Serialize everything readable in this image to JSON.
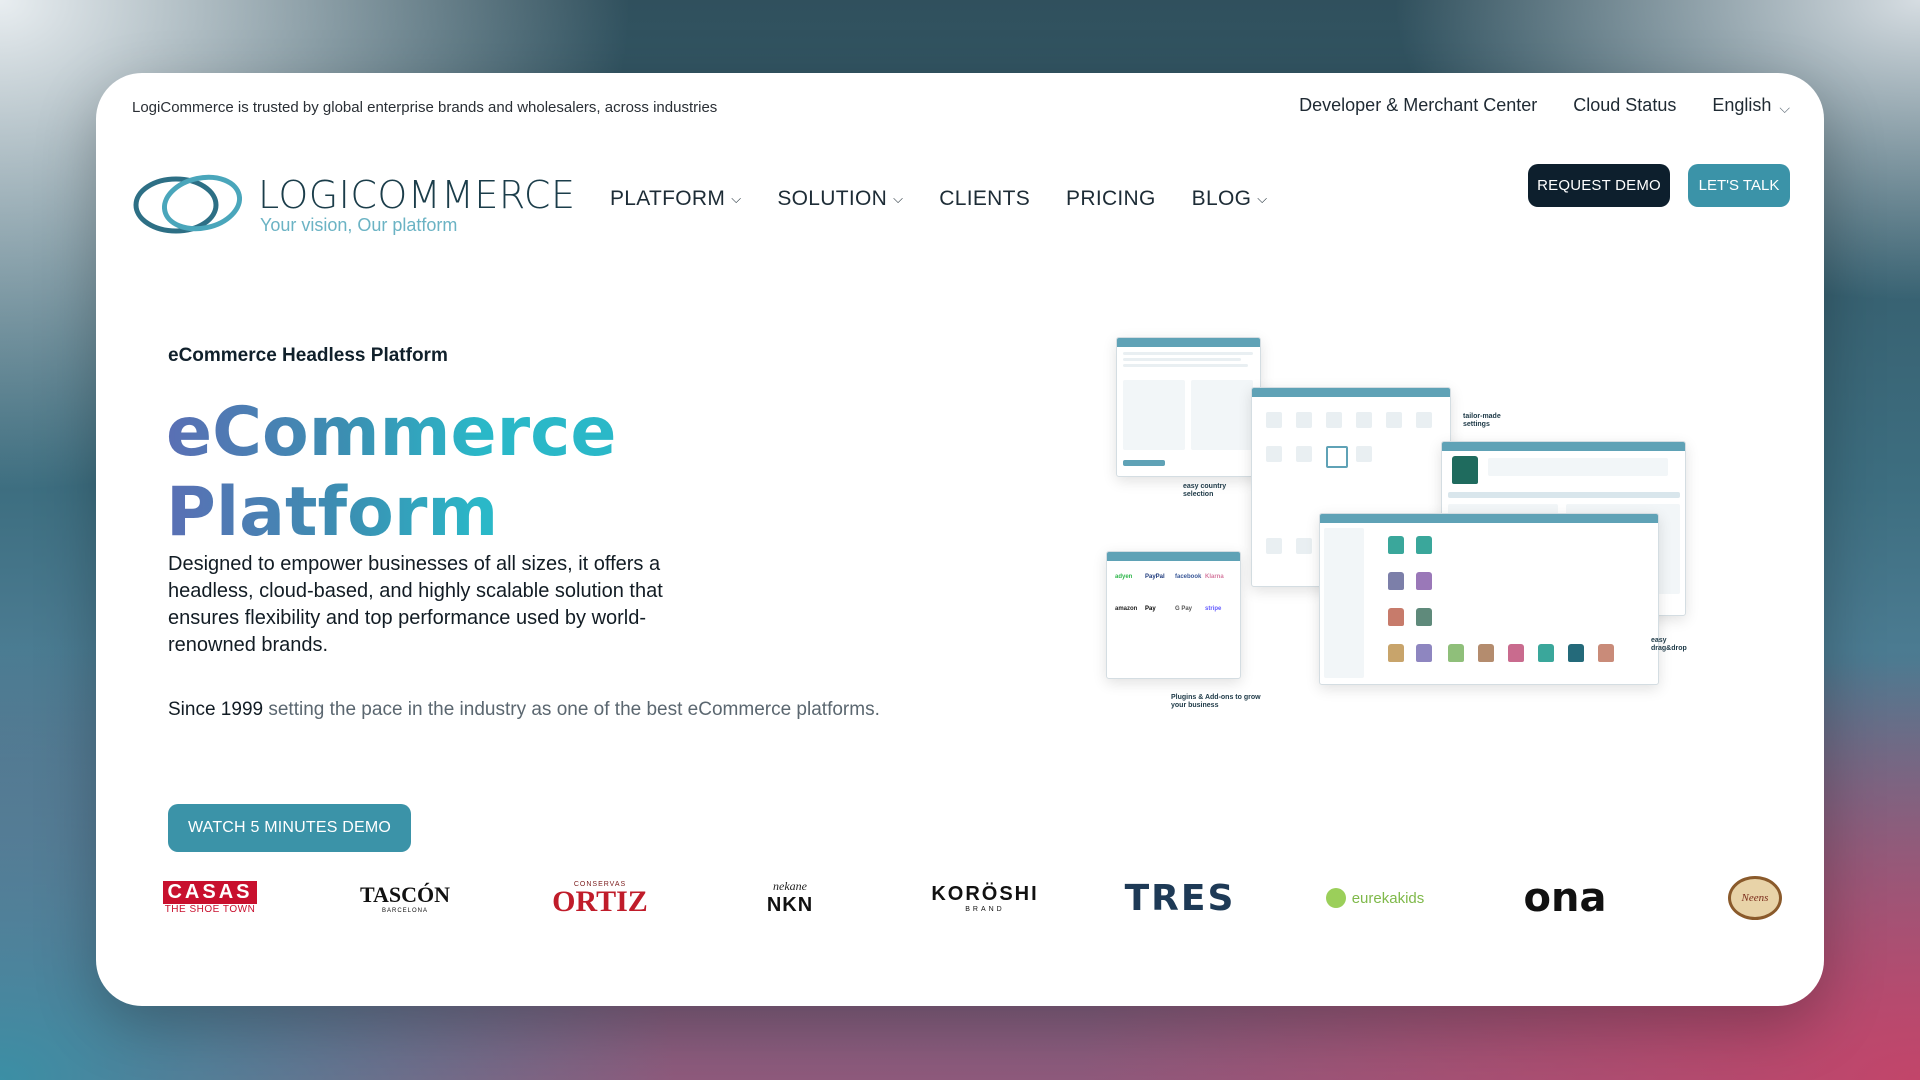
{
  "topbar": {
    "trust_text": "LogiCommerce is trusted by global enterprise brands and wholesalers, across industries",
    "links": [
      "Developer & Merchant Center",
      "Cloud Status"
    ],
    "language": "English"
  },
  "logo": {
    "name": "LOGICOMMERCE",
    "tagline": "Your vision, Our platform"
  },
  "nav": {
    "items": [
      {
        "label": "PLATFORM",
        "dropdown": true
      },
      {
        "label": "SOLUTION",
        "dropdown": true
      },
      {
        "label": "CLIENTS",
        "dropdown": false
      },
      {
        "label": "PRICING",
        "dropdown": false
      },
      {
        "label": "BLOG",
        "dropdown": true
      }
    ]
  },
  "actions": {
    "request_demo": "REQUEST DEMO",
    "lets_talk": "LET'S TALK"
  },
  "hero": {
    "eyebrow": "eCommerce Headless Platform",
    "headline_line1": "eCommerce",
    "headline_line2": "Platform",
    "description": "Designed to empower businesses of all sizes, it offers a headless, cloud-based, and highly scalable solution that ensures flexibility and top performance used by world-renowned brands.",
    "since_bold": "Since 1999",
    "since_rest": " setting the pace in the industry as one of the best eCommerce platforms.",
    "watch_button": "WATCH 5 MINUTES DEMO"
  },
  "collage": {
    "notes": {
      "country": "easy country selection",
      "tailor": "tailor-made settings",
      "drag": "easy drag&drop",
      "plugins": "Plugins & Add-ons to grow your business"
    },
    "payment_labels": [
      "adyen",
      "PayPal",
      "facebook",
      "Klarna",
      "amazon",
      "Pay",
      "G Pay",
      "stripe"
    ]
  },
  "client_logos": [
    "CASAS",
    "THE SHOE TOWN",
    "TASCÓN",
    "BARCELONA",
    "CONSERVAS",
    "ORTIZ",
    "nekane",
    "NKN",
    "KORÖSHI",
    "BRAND",
    "TRES",
    "eurekakids",
    "ona",
    "Neens"
  ],
  "colors": {
    "accent": "#3b93a8",
    "dark_button": "#0d1f2d",
    "headline_start": "#5a6fb4",
    "headline_end": "#2ab8c8"
  }
}
